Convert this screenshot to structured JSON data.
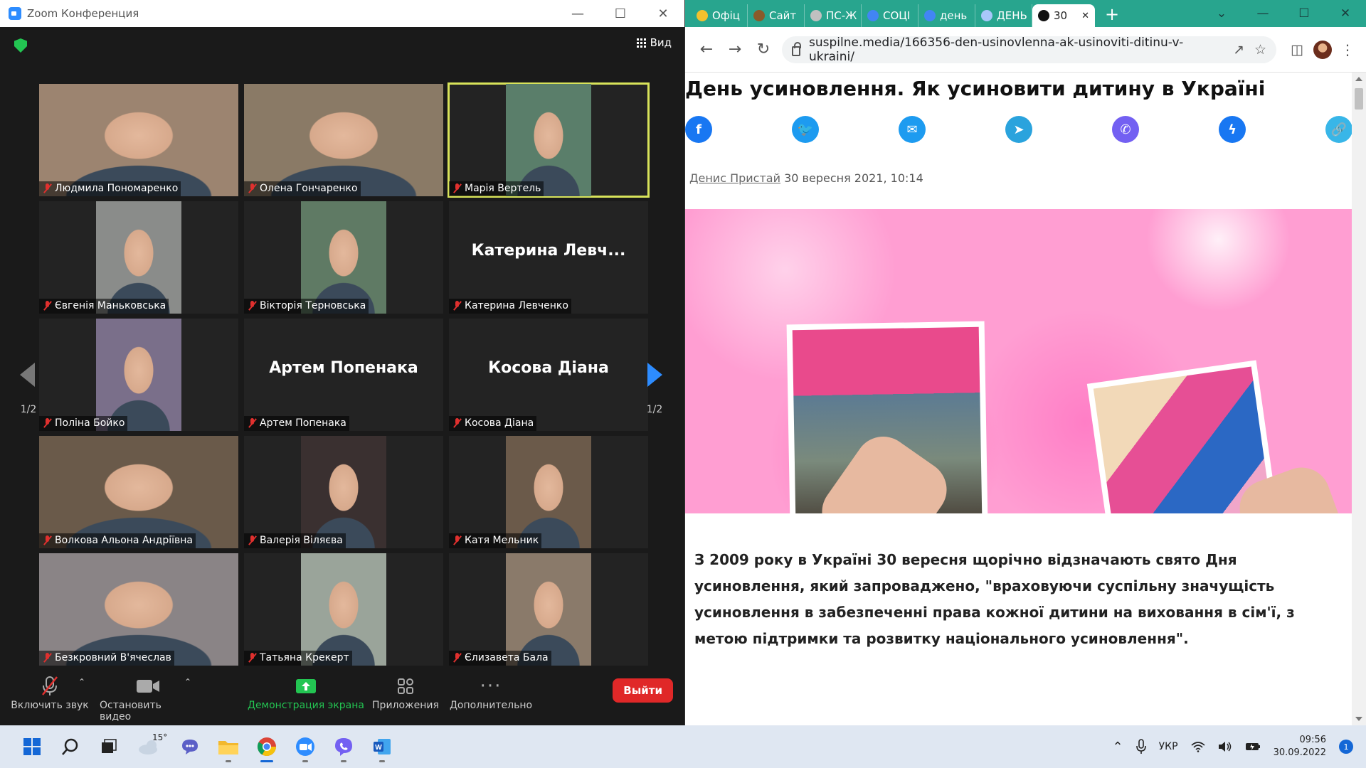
{
  "zoom": {
    "title": "Zoom Конференция",
    "view_label": "Вид",
    "pager": {
      "left": "1/2",
      "right": "1/2"
    },
    "participants": [
      {
        "name": "Людмила Пономаренко",
        "video": "full",
        "bg": "#9c8470",
        "active": false
      },
      {
        "name": "Олена Гончаренко",
        "video": "full",
        "bg": "#8a7a66",
        "active": false
      },
      {
        "name": "Марія Вертель",
        "video": "center",
        "bg": "#5a7e6a",
        "active": true
      },
      {
        "name": "Євгенія Маньковська",
        "video": "center",
        "bg": "#8a8c8a",
        "active": false
      },
      {
        "name": "Вікторія Терновська",
        "video": "center",
        "bg": "#5f7a64",
        "active": false
      },
      {
        "name": "Катерина Левченко",
        "video": "none",
        "bigname": "Катерина Левч...",
        "active": false
      },
      {
        "name": "Поліна Бойко",
        "video": "center",
        "bg": "#7a6f8a",
        "active": false
      },
      {
        "name": "Артем Попенака",
        "video": "none",
        "bigname": "Артем Попенака",
        "active": false
      },
      {
        "name": "Косова Діана",
        "video": "none",
        "bigname": "Косова Діана",
        "active": false
      },
      {
        "name": "Волкова Альона Андріївна",
        "video": "full",
        "bg": "#6a5a4a",
        "active": false
      },
      {
        "name": "Валерія Віляєва",
        "video": "center",
        "bg": "#3a3030",
        "active": false
      },
      {
        "name": "Катя Мельник",
        "video": "center",
        "bg": "#6b5a4a",
        "active": false
      },
      {
        "name": "Безкровний В'ячеслав",
        "video": "full",
        "bg": "#8a8486",
        "active": false
      },
      {
        "name": "Татьяна Крекерт",
        "video": "center",
        "bg": "#9aa49a",
        "active": false
      },
      {
        "name": "Єлизавета Бала",
        "video": "center",
        "bg": "#8a7a6a",
        "active": false
      }
    ],
    "toolbar": {
      "mute": "Включить звук",
      "video": "Остановить видео",
      "share": "Демонстрация экрана",
      "apps": "Приложения",
      "more": "Дополнительно",
      "leave": "Выйти"
    },
    "colors": {
      "share_green": "#23c552",
      "active_border": "#d8e35a",
      "leave_red": "#e02828"
    }
  },
  "browser": {
    "tabs": [
      {
        "title": "Офіц",
        "fav_color": "#f2c12e"
      },
      {
        "title": "Сайт",
        "fav_color": "#8a5a2a"
      },
      {
        "title": "ПС-Ж",
        "fav_color": "#c0c0c0"
      },
      {
        "title": "СОЦІ",
        "fav_color": "#4285f4"
      },
      {
        "title": "день",
        "fav_color": "#4285f4"
      },
      {
        "title": "ДЕНЬ",
        "fav_color": "#a8c7fa"
      },
      {
        "title": "30",
        "fav_color": "#111111",
        "active": true
      }
    ],
    "url": "suspilne.media/166356-den-usinovlenna-ak-usinoviti-ditinu-v-ukraini/",
    "accent": "#28a58e"
  },
  "article": {
    "title": "День усиновлення. Як усиновити дитину в Україні",
    "author": "Денис Пристай",
    "date": "30 вересня 2021, 10:14",
    "share": [
      {
        "icon": "facebook-icon",
        "glyph": "f",
        "color": "#1877f2"
      },
      {
        "icon": "twitter-icon",
        "glyph": "🐦",
        "color": "#1d9bf0"
      },
      {
        "icon": "email-icon",
        "glyph": "✉",
        "color": "#1d9bf0"
      },
      {
        "icon": "telegram-icon",
        "glyph": "➤",
        "color": "#2aa3dd"
      },
      {
        "icon": "viber-icon",
        "glyph": "✆",
        "color": "#7360f2"
      },
      {
        "icon": "messenger-icon",
        "glyph": "ϟ",
        "color": "#1877f2"
      },
      {
        "icon": "link-icon",
        "glyph": "🔗",
        "color": "#38b6e8"
      }
    ],
    "body": "З 2009 року в Україні 30 вересня щорічно відзначають свято Дня усиновлення, який запроваджено, \"враховуючи суспільну значущість усиновлення в забезпеченні права кожної дитини на виховання в сім'ї, з метою підтримки та розвитку національного усиновлення\"."
  },
  "taskbar": {
    "weather": "15°",
    "lang": "УКР",
    "time": "09:56",
    "date": "30.09.2022",
    "notifications": "1"
  }
}
